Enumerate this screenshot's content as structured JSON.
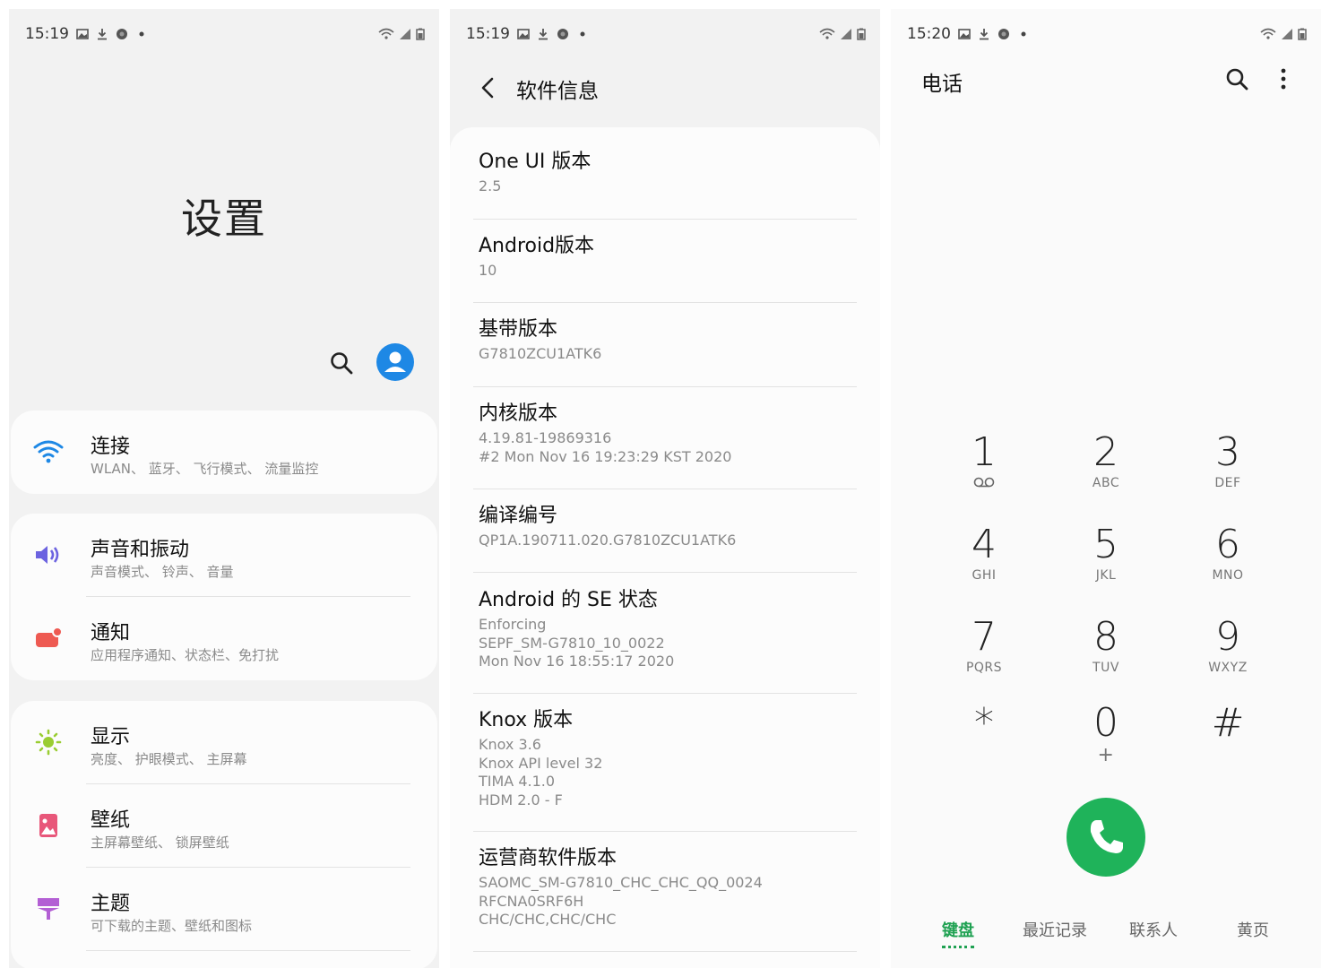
{
  "settings": {
    "status_time": "15:19",
    "title": "设置",
    "cards": [
      {
        "items": [
          {
            "title": "连接",
            "subtitle": "WLAN、 蓝牙、 飞行模式、 流量监控",
            "icon": "wifi-icon"
          }
        ]
      },
      {
        "items": [
          {
            "title": "声音和振动",
            "subtitle": "声音模式、 铃声、 音量",
            "icon": "volume-icon"
          },
          {
            "title": "通知",
            "subtitle": "应用程序通知、状态栏、免打扰",
            "icon": "notification-icon"
          }
        ]
      },
      {
        "items": [
          {
            "title": "显示",
            "subtitle": "亮度、 护眼模式、 主屏幕",
            "icon": "brightness-icon"
          },
          {
            "title": "壁纸",
            "subtitle": "主屏幕壁纸、 锁屏壁纸",
            "icon": "wallpaper-icon"
          },
          {
            "title": "主题",
            "subtitle": "可下载的主题、壁纸和图标",
            "icon": "theme-icon"
          }
        ]
      }
    ],
    "colors": {
      "accent": "#1e88e5",
      "wifi": "#1e88e5",
      "volume": "#6c63e0",
      "notification": "#ee5a52",
      "display": "#9acd32",
      "wallpaper": "#e8577a",
      "theme": "#b35fd4"
    }
  },
  "software_info": {
    "status_time": "15:19",
    "title": "软件信息",
    "items": [
      {
        "title": "One UI 版本",
        "values": [
          "2.5"
        ]
      },
      {
        "title": "Android版本",
        "values": [
          "10"
        ]
      },
      {
        "title": "基带版本",
        "values": [
          "G7810ZCU1ATK6"
        ]
      },
      {
        "title": "内核版本",
        "values": [
          "4.19.81-19869316",
          "#2 Mon Nov 16 19:23:29 KST 2020"
        ]
      },
      {
        "title": "编译编号",
        "values": [
          "QP1A.190711.020.G7810ZCU1ATK6"
        ]
      },
      {
        "title": "Android 的 SE 状态",
        "values": [
          "Enforcing",
          "SEPF_SM-G7810_10_0022",
          "Mon Nov 16 18:55:17 2020"
        ]
      },
      {
        "title": "Knox 版本",
        "values": [
          "Knox 3.6",
          "Knox API level 32",
          "TIMA 4.1.0",
          "HDM 2.0 - F"
        ]
      },
      {
        "title": "运营商软件版本",
        "values": [
          "SAOMC_SM-G7810_CHC_CHC_QQ_0024",
          "RFCNA0SRF6H",
          "CHC/CHC,CHC/CHC"
        ]
      }
    ]
  },
  "phone": {
    "status_time": "15:20",
    "title": "电话",
    "keys": [
      {
        "num": "1",
        "letters": ""
      },
      {
        "num": "2",
        "letters": "ABC"
      },
      {
        "num": "3",
        "letters": "DEF"
      },
      {
        "num": "4",
        "letters": "GHI"
      },
      {
        "num": "5",
        "letters": "JKL"
      },
      {
        "num": "6",
        "letters": "MNO"
      },
      {
        "num": "7",
        "letters": "PQRS"
      },
      {
        "num": "8",
        "letters": "TUV"
      },
      {
        "num": "9",
        "letters": "WXYZ"
      },
      {
        "num": "*",
        "letters": ""
      },
      {
        "num": "0",
        "letters": "+"
      },
      {
        "num": "#",
        "letters": ""
      }
    ],
    "tabs": [
      "键盘",
      "最近记录",
      "联系人",
      "黄页"
    ],
    "active_tab": "键盘",
    "colors": {
      "call": "#1fb35a",
      "active_tab": "#1fa152"
    }
  }
}
